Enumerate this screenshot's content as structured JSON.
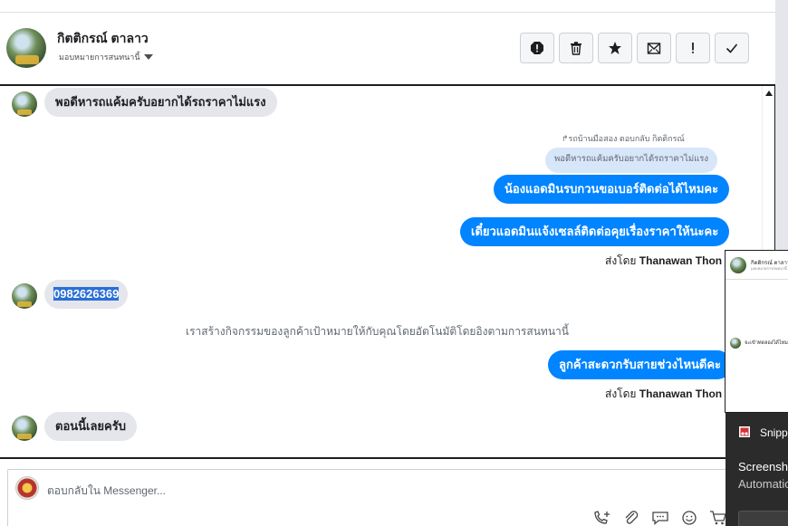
{
  "header": {
    "name": "กิตติกรณ์ ตาลาว",
    "assign_label": "มอบหมายการสนทนานี้"
  },
  "actions": [
    {
      "name": "spam-icon"
    },
    {
      "name": "trash-icon"
    },
    {
      "name": "star-icon"
    },
    {
      "name": "mark-unread-icon"
    },
    {
      "name": "follow-up-icon"
    },
    {
      "name": "done-check-icon"
    }
  ],
  "thread": {
    "msg1": "พอดีหารถแค้มครับอยากได้รถราคาไม่แรง",
    "reply_meta": "↱รถบ้านมือสอง ตอบกลับ กิตติกรณ์",
    "quote": "พอดีหารถแค้มครับอยากได้รถราคาไม่แรง",
    "out1": "น้องแอดมินรบกวนขอเบอร์ติดต่อได้ไหมคะ",
    "out2": "เดี๋ยวแอดมินแจ้งเซลล์ติดต่อคุยเรื่องราคาให้นะคะ",
    "sent_by_prefix": "ส่งโดย",
    "sent_by_name": "Thanawan Thon",
    "phone": "0982626369",
    "notice": "เราสร้างกิจกรรมของลูกค้าเป้าหมายให้กับคุณโดยอัตโนมัติโดยอิงตามการสนทนานี้",
    "out3": "ลูกค้าสะดวกรับสายช่วงไหนดีคะ",
    "sent_by_prefix2": "ส่งโดย",
    "sent_by_name2": "Thanawan Thon",
    "msg_last": "ตอนนี้เลยครับ"
  },
  "composer": {
    "placeholder": "ตอบกลับใน Messenger..."
  },
  "tools": [
    {
      "name": "call-icon"
    },
    {
      "name": "attachment-icon"
    },
    {
      "name": "saved-reply-icon"
    },
    {
      "name": "emoji-icon"
    },
    {
      "name": "cart-icon"
    }
  ],
  "popup": {
    "title": "กิตติกรณ์ ตาลาว",
    "subtitle": "มอบหมายการสนทนานี้",
    "message": "จะเข้าทดลองได้ไหม"
  },
  "toast": {
    "app": "Snipping Tool",
    "title": "Screenshot copied",
    "body": "Automatically saved"
  },
  "colors": {
    "outgoing_bubble": "#0084ff",
    "incoming_bubble": "#e4e6eb",
    "quote_bubble": "#d8e6fa",
    "selection": "#2a6fd6"
  }
}
